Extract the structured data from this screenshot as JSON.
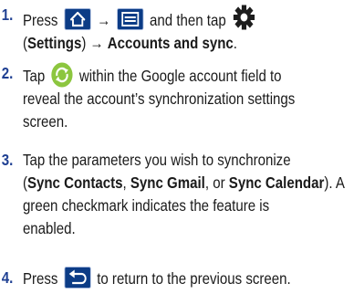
{
  "steps": [
    {
      "number": "1.",
      "press": "Press",
      "arrow1": "→",
      "and_then_tap": "and then tap",
      "paren_open": "(",
      "settings": "Settings",
      "paren_close": ")",
      "arrow2": "→",
      "accounts_and_sync": "Accounts and sync",
      "period": "."
    },
    {
      "number": "2.",
      "tap": "Tap",
      "line1_rest": "within the Google account field to",
      "line2": "reveal the account’s synchronization settings",
      "line3": "screen."
    },
    {
      "number": "3.",
      "line1": "Tap the parameters you wish to synchronize",
      "paren_open": "(",
      "sync_contacts": "Sync Contacts",
      "comma1": ", ",
      "sync_gmail": "Sync Gmail",
      "or": ", or ",
      "sync_calendar": "Sync Calendar",
      "paren_close_a": "). A",
      "line3": "green checkmark indicates the feature is",
      "line4": "enabled."
    },
    {
      "number": "4.",
      "press": "Press",
      "rest": "to return to the previous screen."
    }
  ],
  "icons": {
    "home": "home-icon",
    "menu": "menu-icon",
    "settings": "gear-icon",
    "sync": "sync-icon",
    "back": "back-icon"
  },
  "colors": {
    "step_number": "#1e3f92",
    "key_bg": "#0c3c86",
    "sync_green": "#8cc63f"
  }
}
